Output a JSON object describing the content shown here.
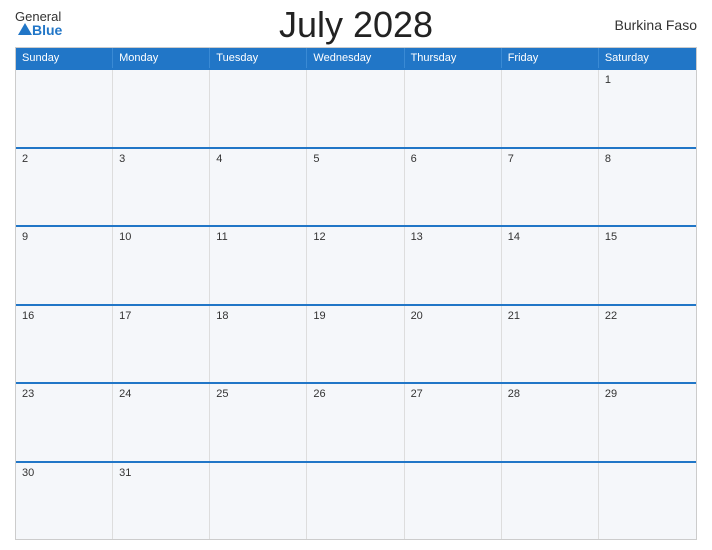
{
  "header": {
    "title": "July 2028",
    "country": "Burkina Faso",
    "logo_general": "General",
    "logo_blue": "Blue"
  },
  "days_of_week": [
    "Sunday",
    "Monday",
    "Tuesday",
    "Wednesday",
    "Thursday",
    "Friday",
    "Saturday"
  ],
  "weeks": [
    [
      null,
      null,
      null,
      null,
      null,
      null,
      1
    ],
    [
      2,
      3,
      4,
      5,
      6,
      7,
      8
    ],
    [
      9,
      10,
      11,
      12,
      13,
      14,
      15
    ],
    [
      16,
      17,
      18,
      19,
      20,
      21,
      22
    ],
    [
      23,
      24,
      25,
      26,
      27,
      28,
      29
    ],
    [
      30,
      31,
      null,
      null,
      null,
      null,
      null
    ]
  ]
}
